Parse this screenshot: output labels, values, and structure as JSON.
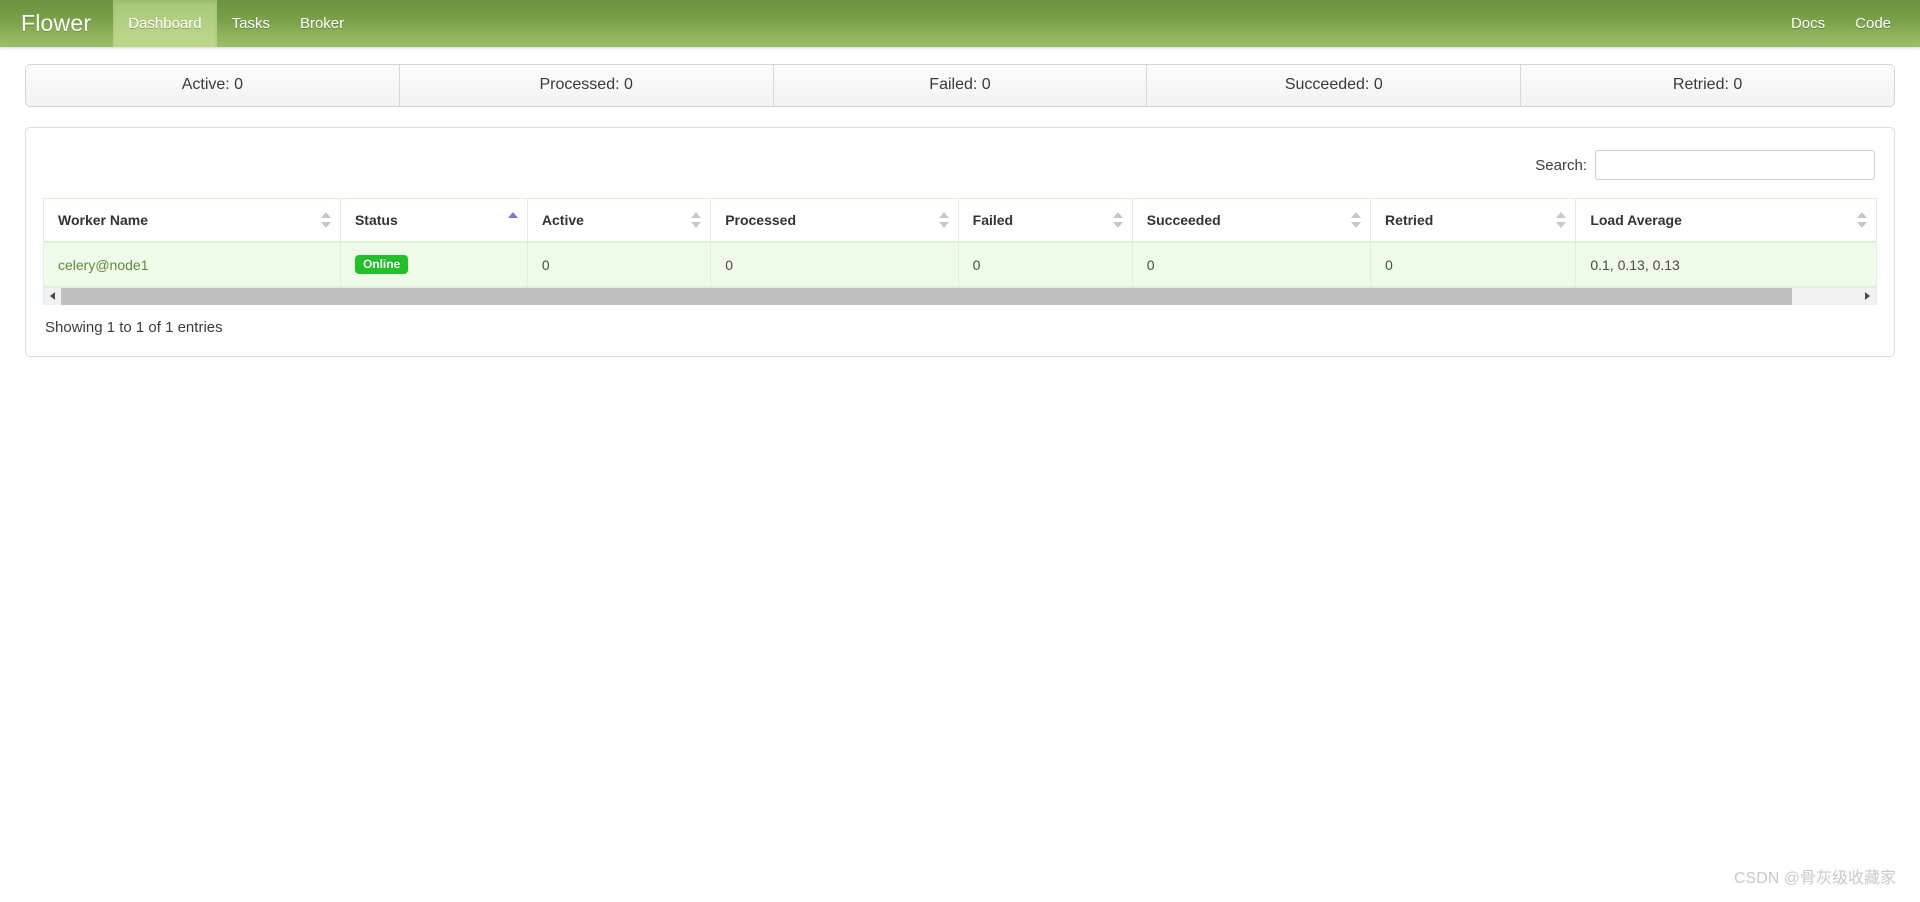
{
  "navbar": {
    "brand": "Flower",
    "left_items": [
      {
        "label": "Dashboard",
        "active": true
      },
      {
        "label": "Tasks",
        "active": false
      },
      {
        "label": "Broker",
        "active": false
      }
    ],
    "right_items": [
      {
        "label": "Docs"
      },
      {
        "label": "Code"
      }
    ]
  },
  "stats": [
    {
      "label": "Active: 0"
    },
    {
      "label": "Processed: 0"
    },
    {
      "label": "Failed: 0"
    },
    {
      "label": "Succeeded: 0"
    },
    {
      "label": "Retried: 0"
    }
  ],
  "search": {
    "label": "Search:",
    "value": "",
    "placeholder": ""
  },
  "table": {
    "columns": [
      {
        "label": "Worker Name",
        "sort": "none"
      },
      {
        "label": "Status",
        "sort": "asc"
      },
      {
        "label": "Active",
        "sort": "none"
      },
      {
        "label": "Processed",
        "sort": "none"
      },
      {
        "label": "Failed",
        "sort": "none"
      },
      {
        "label": "Succeeded",
        "sort": "none"
      },
      {
        "label": "Retried",
        "sort": "none"
      },
      {
        "label": "Load Average",
        "sort": "none"
      }
    ],
    "rows": [
      {
        "worker_name": "celery@node1",
        "status": "Online",
        "active": "0",
        "processed": "0",
        "failed": "0",
        "succeeded": "0",
        "retried": "0",
        "load_average": "0.1, 0.13, 0.13"
      }
    ],
    "info": "Showing 1 to 1 of 1 entries"
  },
  "scrollbar": {
    "left_arrow_icon": "chevron-left-icon",
    "right_arrow_icon": "chevron-right-icon"
  },
  "watermark": "CSDN @骨灰级收藏家",
  "colors": {
    "nav_green_top": "#6b9340",
    "nav_green_bottom": "#9dbd6c",
    "nav_active": "#b6d184",
    "row_green": "#eefbe8",
    "border_green": "#dff0d8",
    "badge_green": "#21c12a",
    "sort_active": "#7b79d6"
  }
}
